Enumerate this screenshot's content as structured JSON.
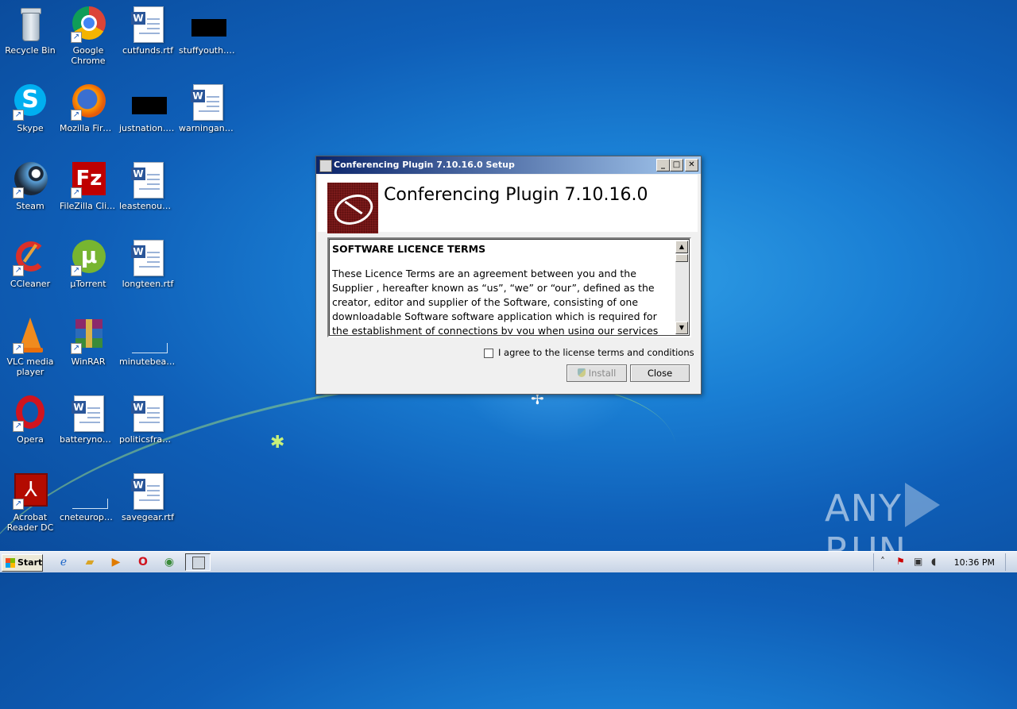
{
  "desktop": {
    "icons": [
      {
        "label": "Recycle Bin"
      },
      {
        "label": "Google Chrome"
      },
      {
        "label": "cutfunds.rtf"
      },
      {
        "label": "stuffyouth.jpg"
      },
      {
        "label": "Skype"
      },
      {
        "label": "Mozilla Firefox"
      },
      {
        "label": "justnation.jpg"
      },
      {
        "label": "warningans…"
      },
      {
        "label": "Steam"
      },
      {
        "label": "FileZilla Client"
      },
      {
        "label": "leastenough…"
      },
      {
        "label": "CCleaner"
      },
      {
        "label": "µTorrent"
      },
      {
        "label": "longteen.rtf"
      },
      {
        "label": "VLC media player"
      },
      {
        "label": "WinRAR"
      },
      {
        "label": "minutebeau…"
      },
      {
        "label": "Opera"
      },
      {
        "label": "batterynow…"
      },
      {
        "label": "politicsfranc…"
      },
      {
        "label": "Acrobat Reader DC"
      },
      {
        "label": "cneteuroper…"
      },
      {
        "label": "savegear.rtf"
      }
    ]
  },
  "dialog": {
    "title": "Conferencing Plugin 7.10.16.0 Setup",
    "product_name": "Conferencing Plugin 7.10.16.0",
    "license_heading": "SOFTWARE LICENCE TERMS",
    "license_body": "These Licence Terms are an agreement between you and the Supplier , hereafter known as “us”, “we” or “our”, defined as the creator, editor and supplier of the Software, consisting of one downloadable Software software application which is required for the establishment of connections by you when using our services and you.",
    "agree_label": "I agree to the license terms and conditions",
    "agree_checked": false,
    "install_label": "Install",
    "close_label": "Close",
    "minimize_glyph": "_",
    "maximize_glyph": "□",
    "close_glyph": "✕"
  },
  "watermark": {
    "text_left": "ANY",
    "text_right": "RUN"
  },
  "taskbar": {
    "start_label": "Start",
    "clock": "10:36 PM"
  }
}
